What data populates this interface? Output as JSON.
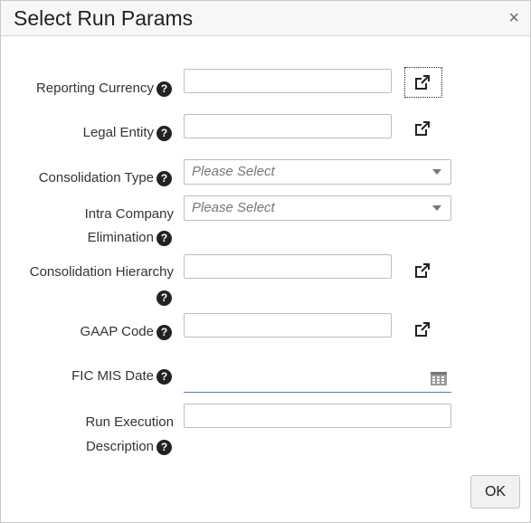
{
  "dialog": {
    "title": "Select Run Params",
    "close_symbol": "×",
    "ok_label": "OK"
  },
  "help_glyph": "?",
  "fields": {
    "reporting_currency": {
      "label": "Reporting Currency",
      "value": ""
    },
    "legal_entity": {
      "label": "Legal Entity",
      "value": ""
    },
    "consolidation_type": {
      "label": "Consolidation Type",
      "selected": "Please Select"
    },
    "intra_company_elimination": {
      "label_line1": "Intra Company",
      "label_line2": "Elimination",
      "selected": "Please Select"
    },
    "consolidation_hierarchy": {
      "label": "Consolidation Hierarchy",
      "value": ""
    },
    "gaap_code": {
      "label": "GAAP Code",
      "value": ""
    },
    "fic_mis_date": {
      "label": "FIC MIS Date",
      "value": ""
    },
    "run_execution_description": {
      "label_line1": "Run Execution",
      "label_line2": "Description",
      "value": ""
    }
  },
  "icons": {
    "external_link": "external-link-icon",
    "calendar": "calendar-icon",
    "help": "help-icon",
    "close": "close-icon",
    "dropdown": "chevron-down-icon"
  },
  "colors": {
    "help_bg": "#222222",
    "date_underline": "#4a7ab5",
    "titlebar_bg": "#f7f7f7"
  }
}
